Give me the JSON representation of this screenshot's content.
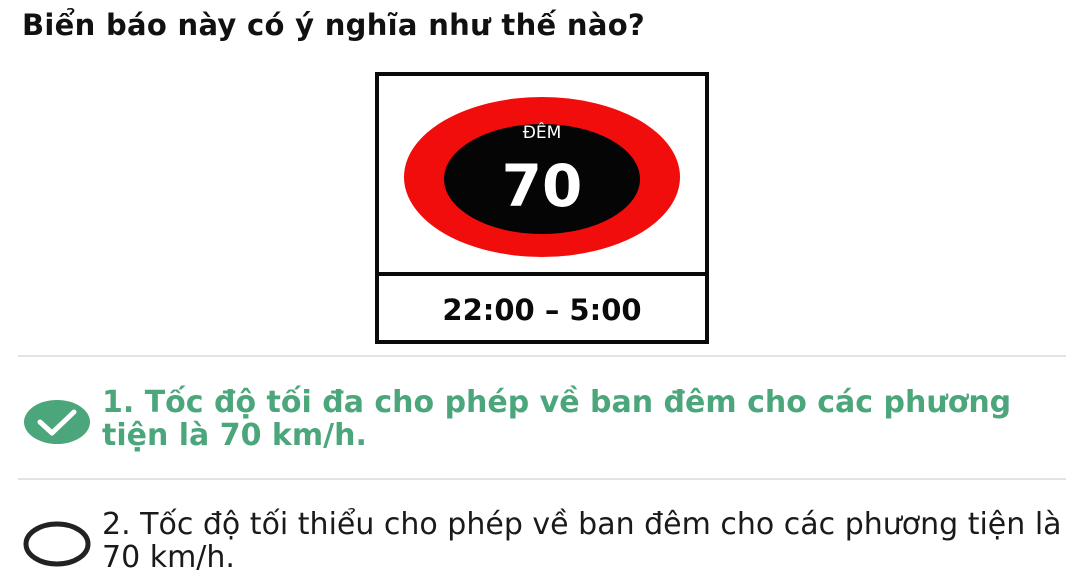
{
  "question": {
    "text": "Biển báo này có ý nghĩa như thế nào?"
  },
  "sign": {
    "top_label": "ĐÊM",
    "speed": "70",
    "time_range": "22:00 – 5:00",
    "ring_color": "#f20d0d",
    "disc_color": "#050505"
  },
  "answers": [
    {
      "text": "1. Tốc độ tối đa cho phép về ban đêm cho các phương tiện là 70 km/h.",
      "selected": true,
      "state_icon": "check-circle-icon",
      "color": "#4ca67c"
    },
    {
      "text": "2. Tốc độ tối thiểu cho phép về ban đêm cho các phương tiện là 70 km/h.",
      "selected": false,
      "state_icon": "empty-radio-icon",
      "color": "#1a1a1a"
    }
  ]
}
